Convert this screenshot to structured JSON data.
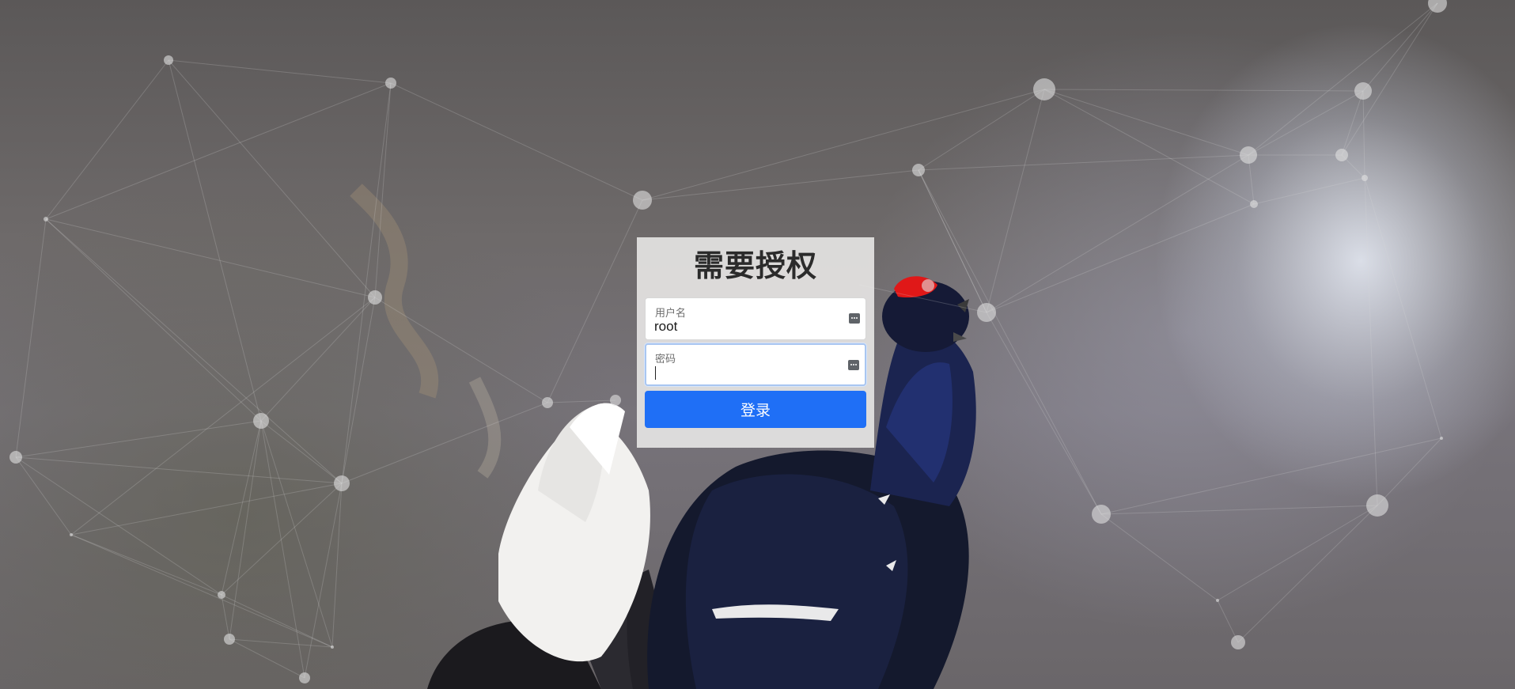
{
  "login": {
    "title": "需要授权",
    "username_label": "用户名",
    "username_value": "root",
    "password_label": "密码",
    "password_value": "",
    "submit_label": "登录",
    "accent_color": "#1f6ff6"
  },
  "background": {
    "icons": [
      "network-particles",
      "bird-photo"
    ]
  }
}
